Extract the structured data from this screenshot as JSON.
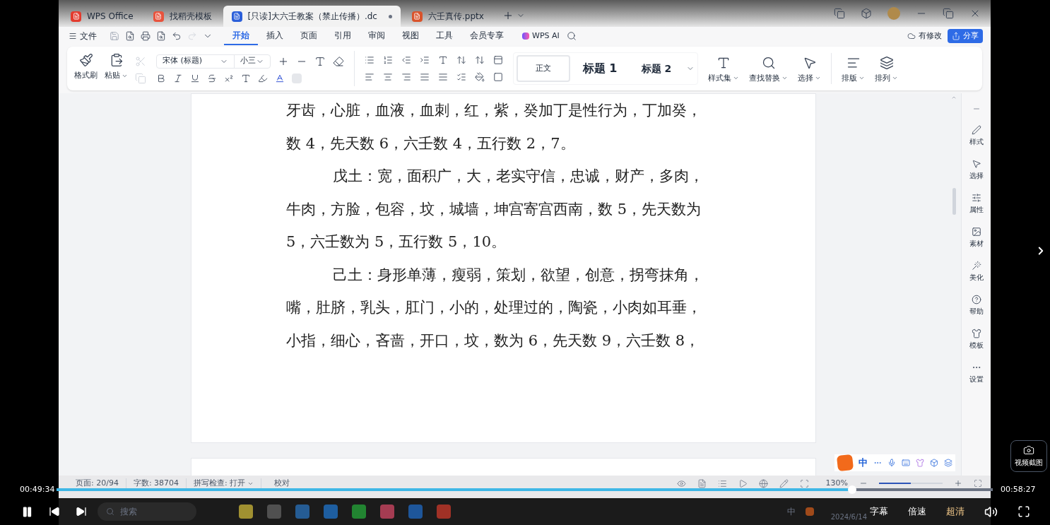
{
  "tabs": [
    {
      "label": "WPS Office",
      "kind": "wps",
      "selected": false
    },
    {
      "label": "找稻壳模板",
      "kind": "docer",
      "selected": false
    },
    {
      "label": "[只读]大六壬教案（禁止传播）.dc",
      "kind": "word",
      "selected": true
    },
    {
      "label": "六壬真传.pptx",
      "kind": "ppt",
      "selected": false
    }
  ],
  "menu": {
    "file": "文件",
    "items": [
      {
        "label": "开始",
        "selected": true
      },
      {
        "label": "插入",
        "selected": false
      },
      {
        "label": "页面",
        "selected": false
      },
      {
        "label": "引用",
        "selected": false
      },
      {
        "label": "审阅",
        "selected": false
      },
      {
        "label": "视图",
        "selected": false
      },
      {
        "label": "工具",
        "selected": false
      },
      {
        "label": "会员专享",
        "selected": false
      }
    ],
    "ai": "WPS AI",
    "modified": "有修改",
    "share": "分享"
  },
  "ribbon": {
    "clipboard": [
      "格式刷",
      "粘贴"
    ],
    "font": "宋体 (标题)",
    "size": "小三",
    "styles": [
      {
        "label": "正文",
        "kind": "body",
        "selected": true
      },
      {
        "label": "标题 1",
        "kind": "h1",
        "selected": false
      },
      {
        "label": "标题 2",
        "kind": "h2",
        "selected": false
      }
    ],
    "tools": [
      "样式集",
      "查找替换",
      "选择",
      "排版",
      "排列"
    ]
  },
  "document": {
    "lines": [
      {
        "text": "牙齿，心脏，血液，血刺，红，紫，癸加丁是性行为，丁加癸，",
        "indent": false
      },
      {
        "text": "数 4，先天数 6，六壬数 4，五行数 2，7。",
        "indent": false
      },
      {
        "text": "戊土：宽，面积广，大，老实守信，忠诚，财产，多肉，",
        "indent": true
      },
      {
        "text": "牛肉，方脸，包容，坟，城墙，坤宫寄宫西南，数 5，先天数为",
        "indent": false
      },
      {
        "text": "5，六壬数为 5，五行数 5，10。",
        "indent": false
      },
      {
        "text": "己土：身形单薄，瘦弱，策划，欲望，创意，拐弯抹角，",
        "indent": true
      },
      {
        "text": "嘴，肚脐，乳头，肛门，小的，处理过的，陶瓷，小肉如耳垂，",
        "indent": false
      },
      {
        "text": "小指，细心，吝啬，开口，坟，数为 6，先天数 9，六壬数 8，",
        "indent": false
      }
    ]
  },
  "sidebar": [
    "样式",
    "选择",
    "属性",
    "素材",
    "美化",
    "帮助",
    "模板",
    "设置"
  ],
  "ime": {
    "mode": "中"
  },
  "status_bar": {
    "page": "页面: 20/94",
    "words": "字数: 38704",
    "spell": "拼写检查: 打开",
    "proofread": "校对",
    "zoom": "130%",
    "zoom_slider": {
      "level": 0.5
    }
  },
  "taskbar": {
    "search": "搜索",
    "tray_ime": "中",
    "date": "2024/6/14"
  },
  "player": {
    "elapsed": "00:49:34",
    "total": "00:58:27",
    "level": 0.85,
    "options": [
      {
        "label": "字幕",
        "selected": false
      },
      {
        "label": "倍速",
        "selected": false
      },
      {
        "label": "超清",
        "selected": true
      }
    ],
    "screenshot": "视频截图"
  }
}
